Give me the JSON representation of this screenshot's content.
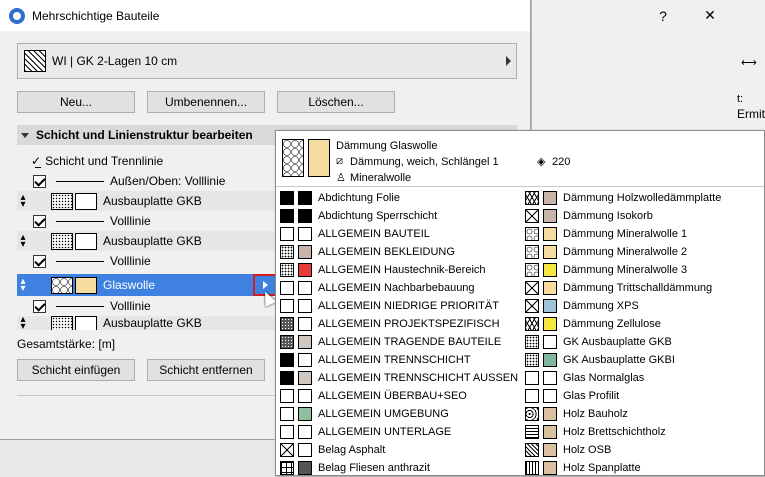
{
  "dialog": {
    "title": "Mehrschichtige Bauteile",
    "help": "?",
    "close": "✕"
  },
  "combo": {
    "value": "WI | GK 2-Lagen 10 cm"
  },
  "buttons": {
    "new": "Neu...",
    "rename": "Umbenennen...",
    "delete": "Löschen...",
    "insert_layer": "Schicht einfügen",
    "remove_layer": "Schicht entfernen"
  },
  "section": {
    "title": "Schicht und Linienstruktur bearbeiten"
  },
  "layers": {
    "header": "Schicht und Trennlinie",
    "rows": [
      {
        "type": "line",
        "label": "Außen/Oben: Volllinie"
      },
      {
        "type": "layer",
        "label": "Ausbauplatte GKB"
      },
      {
        "type": "line",
        "label": "Volllinie"
      },
      {
        "type": "layer",
        "label": "Ausbauplatte GKB"
      },
      {
        "type": "line",
        "label": "Volllinie"
      },
      {
        "type": "layer",
        "label": "Glaswolle"
      },
      {
        "type": "line",
        "label": "Volllinie"
      },
      {
        "type": "layer",
        "label": "Ausbauplatte GKB"
      }
    ]
  },
  "total": {
    "label": "Gesamtstärke: [m]"
  },
  "bg": {
    "text1": "Ermitt",
    "text2": "t:"
  },
  "popup": {
    "header": {
      "name": "Dämmung  Glaswolle",
      "fill": "Dämmung, weich, Schlängel 1",
      "priority": "220",
      "surface": "Mineralwolle"
    },
    "left": [
      {
        "label": "Abdichtung  Folie",
        "pat": "pat-black",
        "color": "#000000"
      },
      {
        "label": "Abdichtung  Sperrschicht",
        "pat": "pat-black",
        "color": "#000000"
      },
      {
        "label": "ALLGEMEIN  BAUTEIL",
        "pat": "",
        "color": "#ffffff"
      },
      {
        "label": "ALLGEMEIN  BEKLEIDUNG",
        "pat": "pat-dots",
        "color": "#c8b4a8"
      },
      {
        "label": "ALLGEMEIN  Haustechnik-Bereich",
        "pat": "pat-dots",
        "color": "#e83a3a"
      },
      {
        "label": "ALLGEMEIN  Nachbarbebauung",
        "pat": "",
        "color": "#ffffff"
      },
      {
        "label": "ALLGEMEIN  NIEDRIGE PRIORITÄT",
        "pat": "",
        "color": "#ffffff"
      },
      {
        "label": "ALLGEMEIN  PROJEKTSPEZIFISCH",
        "pat": "pat-dense",
        "color": "#ffffff"
      },
      {
        "label": "ALLGEMEIN  TRAGENDE BAUTEILE",
        "pat": "pat-dense",
        "color": "#d0c8c0"
      },
      {
        "label": "ALLGEMEIN  TRENNSCHICHT",
        "pat": "pat-black",
        "color": "#ffffff"
      },
      {
        "label": "ALLGEMEIN  TRENNSCHICHT AUSSEN",
        "pat": "pat-black",
        "color": "#d0c8c0"
      },
      {
        "label": "ALLGEMEIN  ÜBERBAU+SEO",
        "pat": "",
        "color": "#ffffff"
      },
      {
        "label": "ALLGEMEIN  UMGEBUNG",
        "pat": "",
        "color": "#8fbf9f"
      },
      {
        "label": "ALLGEMEIN  UNTERLAGE",
        "pat": "",
        "color": "#ffffff"
      },
      {
        "label": "Belag  Asphalt",
        "pat": "pat-x",
        "color": "#ffffff"
      },
      {
        "label": "Belag  Fliesen anthrazit",
        "pat": "pat-grid",
        "color": "#555555"
      }
    ],
    "right": [
      {
        "label": "Dämmung  Holzwolledämmplatte",
        "pat": "pat-zig",
        "color": "#c8b4a8"
      },
      {
        "label": "Dämmung  Isokorb",
        "pat": "pat-x",
        "color": "#c8b4a8"
      },
      {
        "label": "Dämmung  Mineralwolle 1",
        "pat": "pat-circle",
        "color": "#f5dca0"
      },
      {
        "label": "Dämmung  Mineralwolle 2",
        "pat": "pat-circle",
        "color": "#f5dca0"
      },
      {
        "label": "Dämmung  Mineralwolle 3",
        "pat": "pat-circle",
        "color": "#f5e642"
      },
      {
        "label": "Dämmung  Trittschalldämmung",
        "pat": "pat-x",
        "color": "#f5dca0"
      },
      {
        "label": "Dämmung  XPS",
        "pat": "pat-x",
        "color": "#9fc4d8"
      },
      {
        "label": "Dämmung  Zellulose",
        "pat": "pat-zig",
        "color": "#f5e642"
      },
      {
        "label": "GK  Ausbauplatte GKB",
        "pat": "pat-dots",
        "color": "#ffffff"
      },
      {
        "label": "GK  Ausbauplatte GKBI",
        "pat": "pat-dots",
        "color": "#7fb89a"
      },
      {
        "label": "Glas  Normalglas",
        "pat": "",
        "color": "#ffffff"
      },
      {
        "label": "Glas  Profilit",
        "pat": "",
        "color": "#ffffff"
      },
      {
        "label": "Holz  Bauholz",
        "pat": "pat-wood",
        "color": "#d8c0a0"
      },
      {
        "label": "Holz  Brettschichtholz",
        "pat": "pat-lines",
        "color": "#d8c0a0"
      },
      {
        "label": "Holz  OSB",
        "pat": "pat-hatch",
        "color": "#d8c0a0"
      },
      {
        "label": "Holz  Spanplatte",
        "pat": "pat-stripes",
        "color": "#d8c0a0"
      }
    ]
  }
}
